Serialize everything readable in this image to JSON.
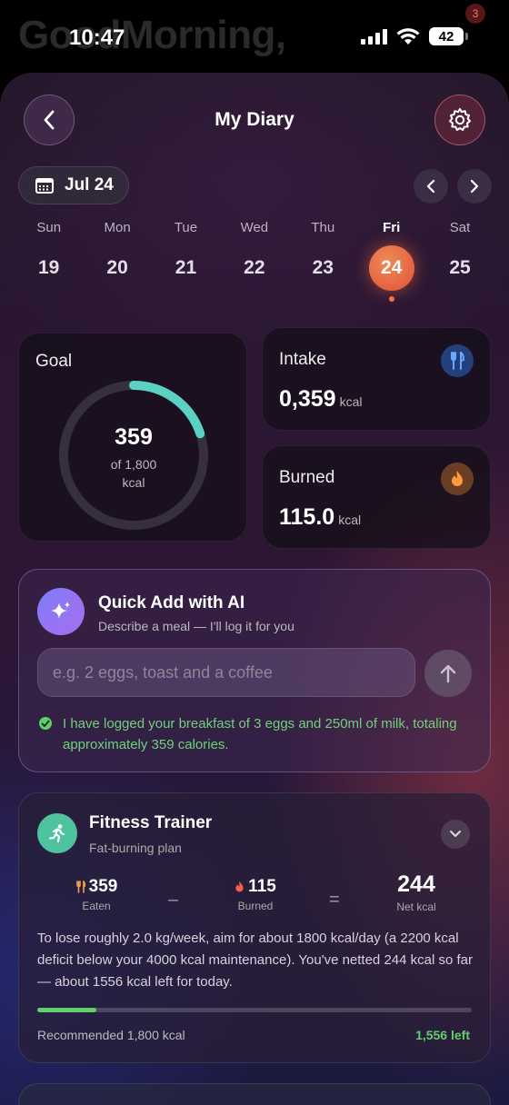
{
  "status": {
    "ghost_title": "GoodMorning,",
    "time": "10:47",
    "battery": "42",
    "notification_count": "3"
  },
  "header": {
    "title": "My Diary"
  },
  "date_selector": {
    "label": "Jul 24"
  },
  "week": [
    {
      "name": "Sun",
      "num": "19"
    },
    {
      "name": "Mon",
      "num": "20"
    },
    {
      "name": "Tue",
      "num": "21"
    },
    {
      "name": "Wed",
      "num": "22"
    },
    {
      "name": "Thu",
      "num": "23"
    },
    {
      "name": "Fri",
      "num": "24",
      "selected": true
    },
    {
      "name": "Sat",
      "num": "25"
    }
  ],
  "goal": {
    "label": "Goal",
    "value": "359",
    "of_text": "of 1,800",
    "unit": "kcal",
    "progress_fraction": 0.2,
    "ring_color": "#5bd1c3"
  },
  "intake": {
    "label": "Intake",
    "value": "0,359",
    "unit": "kcal",
    "icon": "fork-knife-icon",
    "icon_color": "#3f7fe0"
  },
  "burned": {
    "label": "Burned",
    "value": "115.0",
    "unit": "kcal",
    "icon": "flame-icon",
    "icon_color": "#f08a3a"
  },
  "quick_add": {
    "title": "Quick Add with AI",
    "subtitle": "Describe a meal — I'll log it for you",
    "placeholder": "e.g. 2 eggs, toast and a coffee",
    "message": "I have logged your breakfast of 3 eggs and 250ml of milk, totaling approximately 359 calories."
  },
  "fitness": {
    "title": "Fitness Trainer",
    "subtitle": "Fat-burning plan",
    "eaten_value": "359",
    "eaten_label": "Eaten",
    "minus": "–",
    "burned_value": "115",
    "burned_label": "Burned",
    "equals": "=",
    "net_value": "244",
    "net_label": "Net kcal",
    "description": "To lose roughly 2.0 kg/week, aim for about 1800 kcal/day (a 2200 kcal deficit below your 4000 kcal maintenance). You've netted 244 kcal so far — about 1556 kcal left for today.",
    "progress_fraction": 0.136,
    "recommended": "Recommended 1,800 kcal",
    "left": "1,556 left"
  }
}
